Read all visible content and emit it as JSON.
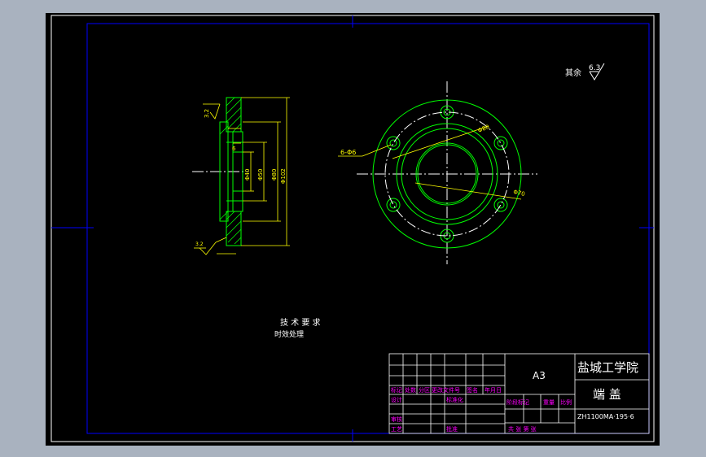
{
  "drawing": {
    "roughness_note": "其余",
    "roughness_value": "6.3",
    "left_roughness": "3.2",
    "small_roughness": "3.2",
    "hole_label": "6-Φ6",
    "dims": {
      "d1": "Φ40",
      "d2": "Φ50",
      "d3": "Φ80",
      "d4": "Φ102",
      "pcd": "Φ80",
      "outer": "Φ70",
      "w1": "6"
    },
    "tech_title": "技 术 要 求",
    "tech_item": "时效处理"
  },
  "title_block": {
    "format": "A3",
    "school": "盐城工学院",
    "part_name": "端  盖",
    "drawing_no": "ZH1100MA·195·6",
    "row_labels": [
      "标记",
      "处数",
      "分区",
      "更改文件号",
      "签名",
      "年月日"
    ],
    "design": "设计",
    "standard": "标准化",
    "review": "审核",
    "process": "工艺",
    "approve": "批准",
    "stage_label": "阶段标记",
    "weight_label": "重量",
    "scale_label": "比例",
    "sheets_label": "共  张 第  张"
  },
  "colors": {
    "bg": "#000000",
    "frame": "#0000ff",
    "part": "#00ff00",
    "dim": "#ffff00",
    "text": "#ffffff",
    "magenta": "#ff00ff"
  }
}
